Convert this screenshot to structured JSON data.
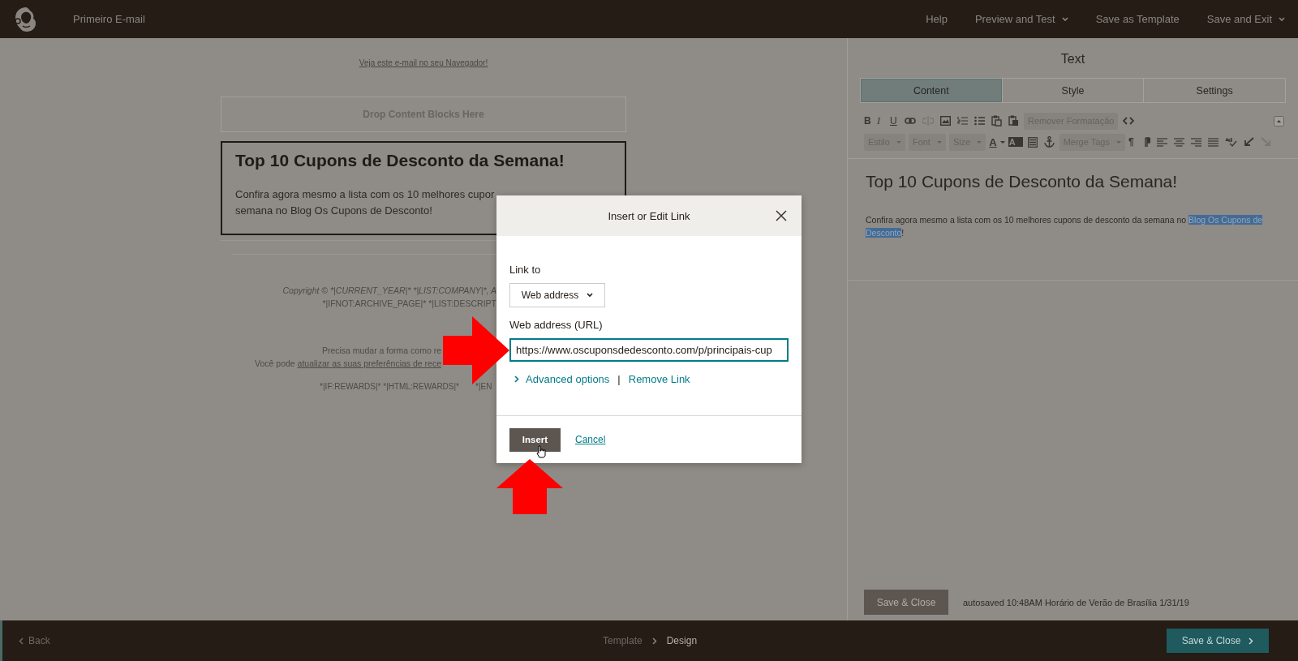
{
  "top_bar": {
    "title": "Primeiro E-mail",
    "links": [
      {
        "label": "Help",
        "dropdown": false
      },
      {
        "label": "Preview and Test",
        "dropdown": true
      },
      {
        "label": "Save as Template",
        "dropdown": false
      },
      {
        "label": "Save and Exit",
        "dropdown": true
      }
    ]
  },
  "email": {
    "browser_link": "Veja este e-mail no seu Navegador!",
    "drop_zone": "Drop Content Blocks Here",
    "heading": "Top 10 Cupons de Desconto da Semana!",
    "body_lines": [
      "Confira agora mesmo a lista com os 10 melhores cupor",
      "semana no Blog Os Cupons de Desconto!"
    ],
    "footer_lines": [
      {
        "kind": "italic",
        "text": "Copyright © *|CURRENT_YEAR|* *|LIST:COMPANY|*, A"
      },
      {
        "kind": "plain",
        "text": "*|IFNOT:ARCHIVE_PAGE|* *|LIST:DESCRIPT"
      },
      {
        "kind": "gap",
        "text": "Precisa mudar a forma como re"
      },
      {
        "kind": "link",
        "text": "Você pode ",
        "link": "atualizar as suas preferências de rece"
      },
      {
        "kind": "split",
        "text": "*|IF:REWARDS|* *|HTML:REWARDS|*",
        "rest": "*|EN"
      }
    ]
  },
  "panel": {
    "title": "Text",
    "tabs": [
      {
        "label": "Content",
        "selected": true
      },
      {
        "label": "Style",
        "selected": false
      },
      {
        "label": "Settings",
        "selected": false
      }
    ],
    "format_buttons": [
      "B",
      "I",
      "U"
    ],
    "clear_button": "Remover Formatação",
    "dropdowns": [
      "Estilo",
      "Font",
      "Size"
    ],
    "color_buttons": [
      "A",
      "A"
    ],
    "merge_tags": "Merge Tags",
    "paragraph_mark": "¶",
    "editor": {
      "heading": "Top 10 Cupons de Desconto da Semana!",
      "text_before": "Confira agora mesmo a lista com os 10 melhores cupons de desconto da semana no ",
      "selected_text": "Blog Os Cupons de Desconto",
      "text_after": "!"
    },
    "save_button": "Save & Close",
    "autosave": "autosaved 10:48AM Horário de Verão de Brasília 1/31/19"
  },
  "dialog": {
    "title": "Insert or Edit Link",
    "link_to_label": "Link to",
    "link_type": "Web address",
    "url_label": "Web address (URL)",
    "url": "https://www.oscuponsdedesconto.com/p/principais-cup",
    "advanced": "Advanced options",
    "separator": "|",
    "remove": "Remove Link",
    "insert": "Insert",
    "cancel": "Cancel"
  },
  "bottom_bar": {
    "back": "Back",
    "steps": [
      {
        "label": "Template",
        "selected": false
      },
      {
        "label": "Design",
        "selected": true
      }
    ],
    "save_button": "Save & Close"
  }
}
